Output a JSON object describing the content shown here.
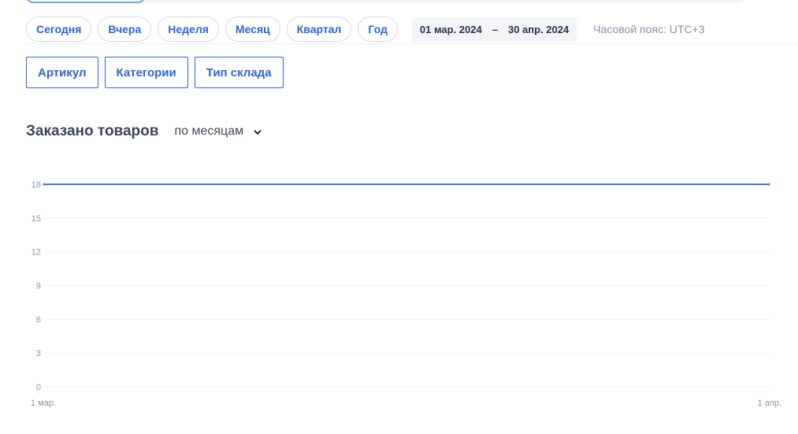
{
  "periods": [
    "Сегодня",
    "Вчера",
    "Неделя",
    "Месяц",
    "Квартал",
    "Год"
  ],
  "date_range": {
    "from": "01 мар. 2024",
    "separator": "–",
    "to": "30 апр. 2024"
  },
  "timezone": "Часовой пояс: UTC+3",
  "filters": [
    "Артикул",
    "Категории",
    "Тип склада"
  ],
  "chart_header": {
    "title": "Заказано товаров",
    "granularity": "по месяцам"
  },
  "colors": {
    "accent": "#2f63d6",
    "line": "#3b7de0",
    "grid": "#eef0f4"
  },
  "chart_data": {
    "type": "line",
    "x": [
      "1 мар.",
      "1 апр."
    ],
    "series": [
      {
        "values": [
          18,
          18
        ]
      }
    ],
    "y_ticks": [
      "0",
      "3",
      "6",
      "9",
      "12",
      "15",
      "18"
    ],
    "ylim": [
      0,
      18
    ],
    "grid": true,
    "title": "",
    "xlabel": "",
    "ylabel": ""
  }
}
